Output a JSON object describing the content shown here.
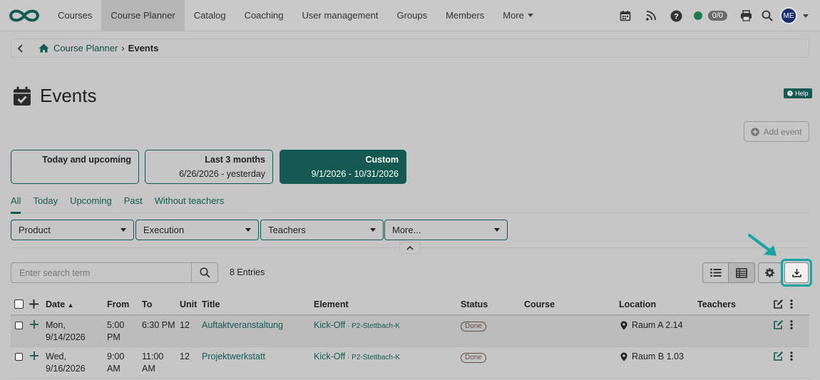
{
  "nav": {
    "items": [
      {
        "label": "Courses"
      },
      {
        "label": "Course Planner"
      },
      {
        "label": "Catalog"
      },
      {
        "label": "Coaching"
      },
      {
        "label": "User management"
      },
      {
        "label": "Groups"
      },
      {
        "label": "Members"
      },
      {
        "label": "More"
      }
    ],
    "counter": "0/0",
    "user_initials": "ME"
  },
  "breadcrumb": {
    "parent": "Course Planner",
    "current": "Events"
  },
  "page": {
    "title": "Events",
    "help_label": "Help",
    "add_event_label": "Add event"
  },
  "periods": [
    {
      "title": "Today and upcoming",
      "subtitle": ""
    },
    {
      "title": "Last 3 months",
      "subtitle": "6/26/2026 - yesterday"
    },
    {
      "title": "Custom",
      "subtitle": "9/1/2026 - 10/31/2026"
    }
  ],
  "tabs": [
    {
      "label": "All"
    },
    {
      "label": "Today"
    },
    {
      "label": "Upcoming"
    },
    {
      "label": "Past"
    },
    {
      "label": "Without teachers"
    }
  ],
  "filters": [
    {
      "label": "Product"
    },
    {
      "label": "Execution"
    },
    {
      "label": "Teachers"
    },
    {
      "label": "More..."
    }
  ],
  "search": {
    "placeholder": "Enter search term",
    "entries": "8 Entries"
  },
  "table": {
    "headers": {
      "date": "Date",
      "from": "From",
      "to": "To",
      "unit": "Unit",
      "title": "Title",
      "element": "Element",
      "status": "Status",
      "course": "Course",
      "location": "Location",
      "teachers": "Teachers"
    },
    "rows": [
      {
        "date_day": "Mon,",
        "date_date": "9/14/2026",
        "from_time": "5:00",
        "from_ampm": "PM",
        "to": "6:30 PM",
        "unit": "12",
        "title": "Auftaktveranstaltung",
        "element": "Kick-Off",
        "element_sep": " · ",
        "element_code": "P2-Stettbach-K",
        "status": "Done",
        "location": "Raum A 2.14"
      },
      {
        "date_day": "Wed,",
        "date_date": "9/16/2026",
        "from_time": "9:00",
        "from_ampm": "AM",
        "to_time": "11:00",
        "to_ampm": "AM",
        "unit": "12",
        "title": "Projektwerkstatt",
        "element": "Kick-Off",
        "element_sep": " · ",
        "element_code": "P2-Stettbach-K",
        "status": "Done",
        "location": "Raum B 1.03"
      }
    ]
  },
  "colors": {
    "accent": "#145a52",
    "highlight": "#19a4a1",
    "status_dot": "#1d7d4a"
  }
}
